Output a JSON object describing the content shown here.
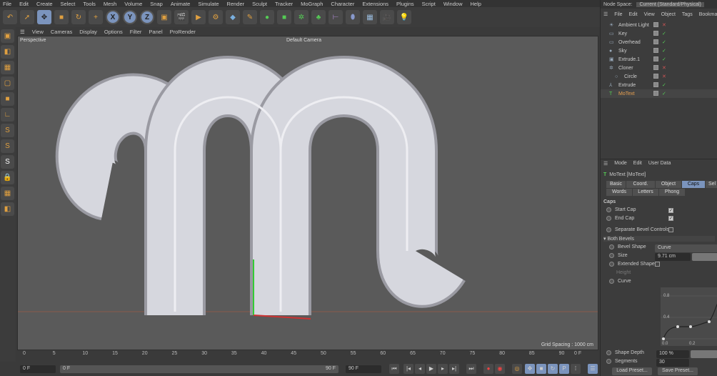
{
  "menu": [
    "File",
    "Edit",
    "Create",
    "Select",
    "Tools",
    "Mesh",
    "Volume",
    "Snap",
    "Animate",
    "Simulate",
    "Render",
    "Sculpt",
    "Tracker",
    "MoGraph",
    "Character",
    "Extensions",
    "Plugins",
    "Script",
    "Window",
    "Help"
  ],
  "toolbar": {
    "axes": [
      "X",
      "Y",
      "Z"
    ]
  },
  "viewport": {
    "menu": [
      "View",
      "Cameras",
      "Display",
      "Options",
      "Filter",
      "Panel",
      "ProRender"
    ],
    "label": "Perspective",
    "camera": "Default Camera",
    "grid_spacing": "Grid Spacing : 1000 cm"
  },
  "timeline": {
    "ticks": [
      "0",
      "5",
      "10",
      "15",
      "20",
      "25",
      "30",
      "35",
      "40",
      "45",
      "50",
      "55",
      "60",
      "65",
      "70",
      "75",
      "80",
      "85",
      "90"
    ],
    "current": "0 F"
  },
  "transport": {
    "start": "0 F",
    "range_start": "0 F",
    "range_end": "90 F",
    "end": "90 F"
  },
  "node_space": {
    "label": "Node Space:",
    "value": "Current (Standard/Physical)"
  },
  "object_manager": {
    "menu": [
      "File",
      "Edit",
      "View",
      "Object",
      "Tags",
      "Bookmarks"
    ],
    "objects": [
      {
        "name": "Ambient Light"
      },
      {
        "name": "Key"
      },
      {
        "name": "Overhead"
      },
      {
        "name": "Sky"
      },
      {
        "name": "Extrude.1"
      },
      {
        "name": "Cloner"
      },
      {
        "name": "Circle"
      },
      {
        "name": "Extrude"
      },
      {
        "name": "MoText"
      }
    ]
  },
  "attributes": {
    "menu": [
      "Mode",
      "Edit",
      "User Data"
    ],
    "object": "MoText [MoText]",
    "tabs_row1": [
      "Basic",
      "Coord.",
      "Object",
      "Caps",
      "Sel"
    ],
    "tabs_row2": [
      "Words",
      "Letters",
      "Phong"
    ],
    "section": "Caps",
    "start_cap": "Start Cap",
    "end_cap": "End Cap",
    "separate": "Separate Bevel Controls",
    "both": "▾ Both Bevels",
    "bevel_shape_label": "Bevel Shape",
    "bevel_shape": "Curve",
    "size_label": "Size",
    "size": "9.71 cm",
    "extended": "Extended Shape",
    "height_label": "Height",
    "curve": "Curve",
    "curve_ticks": [
      "0.8",
      "0.4",
      "0.0",
      "0.2"
    ],
    "shape_depth_label": "Shape Depth",
    "shape_depth": "100 %",
    "segments_label": "Segments",
    "segments": "30",
    "load": "Load Preset...",
    "save": "Save Preset..."
  }
}
